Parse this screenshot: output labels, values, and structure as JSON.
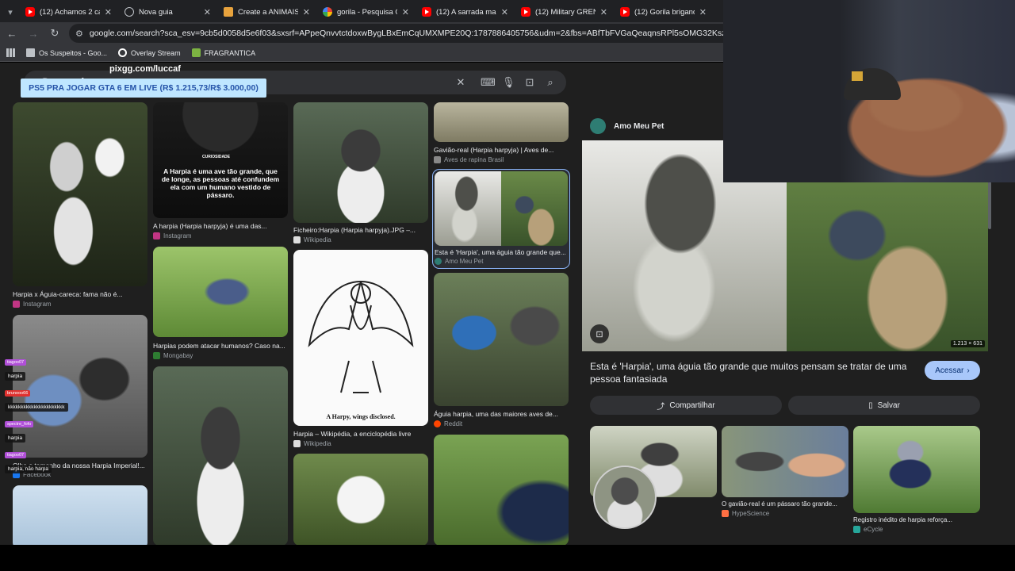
{
  "tabs": [
    {
      "title": "(12) Achamos 2 cangu",
      "icon": "youtube-icon",
      "active": false
    },
    {
      "title": "Nova guia",
      "icon": "globe-icon",
      "active": false
    },
    {
      "title": "Create a ANIMAIS QU",
      "icon": "doc-icon",
      "active": false
    },
    {
      "title": "gorila - Pesquisa Goo",
      "icon": "google-icon",
      "active": false
    },
    {
      "title": "(12) A sarrada mais tr",
      "icon": "youtube-icon",
      "active": false
    },
    {
      "title": "(12) Military GRENAD",
      "icon": "youtube-icon",
      "active": false
    },
    {
      "title": "(12) Gorila brigando l",
      "icon": "youtube-icon",
      "active": false
    }
  ],
  "address": {
    "url": "google.com/search?sca_esv=9cb5d0058d5e6f03&sxsrf=APpeQnvvtctdoxwBygLBxEmCqUMXMPE20Q:1787886405756&udm=2&fbs=ABfTbFVGaQeaqnsRPl5sOMG32KszkLt6nAp8aiRKj5vMjqZApKYr"
  },
  "bookmarks": [
    {
      "label": "",
      "icon": "apps-icon"
    },
    {
      "label": "Os Suspeitos - Goo...",
      "icon": "folder-icon"
    },
    {
      "label": "Overlay Stream",
      "icon": "overlay-icon"
    },
    {
      "label": "FRAGRANTICA",
      "icon": "fragrantica-icon"
    }
  ],
  "search": {
    "logo": "Google"
  },
  "overlay": {
    "stream_url": "pixgg.com/luccaf",
    "donation_text": "PS5 PRA JOGAR GTA 6 EM LIVE (R$ 1.215,73/R$ 3.000,00)"
  },
  "results": {
    "col1": [
      {
        "caption": "Harpia x Águia-careca: fama não é...",
        "source": "Instagram"
      },
      {
        "caption": "Olha o tamanho da nossa Harpia Imperial!...",
        "source": "Facebook"
      }
    ],
    "col2": [
      {
        "caption": "A harpia (Harpia harpyja) é uma das...",
        "source": "Instagram",
        "overlay_text": "A Harpia é uma ave tão grande, que de longe, as pessoas até confundem ela com um humano vestido de pássaro.",
        "overlay_tag": "CURIOSIDADE"
      },
      {
        "caption": "Harpias podem atacar humanos? Caso na...",
        "source": "Mongabay"
      }
    ],
    "col3": [
      {
        "caption": "Ficheiro:Harpia (Harpia harpyja).JPG –...",
        "source": "Wikipedia"
      },
      {
        "caption": "Harpia – Wikipédia, a enciclopédia livre",
        "source": "Wikipedia",
        "drawing_text": "A Harpy, wings disclosed."
      }
    ],
    "col4": [
      {
        "caption": "Gavião-real (Harpia harpyja) | Aves de...",
        "source": "Aves de rapina Brasil"
      },
      {
        "caption": "Esta é 'Harpia', uma águia tão grande que...",
        "source": "Amo Meu Pet"
      },
      {
        "caption": "Águia harpia, uma das maiores aves de...",
        "source": "Reddit"
      }
    ]
  },
  "panel": {
    "source": "Amo Meu Pet",
    "dimensions": "1.213 × 631",
    "title": "Esta é 'Harpia', uma águia tão grande que muitos pensam se tratar de uma pessoa fantasiada",
    "visit_label": "Acessar",
    "share_label": "Compartilhar",
    "save_label": "Salvar",
    "related": [
      {
        "caption": "",
        "source": ""
      },
      {
        "caption": "O gavião-real é um pássaro tão grande...",
        "source": "HypeScience"
      },
      {
        "caption": "Registro inédito de harpia reforça...",
        "source": "eCycle"
      }
    ]
  },
  "chat": [
    {
      "user": "tiagoo07",
      "message": "harpia",
      "color": "#b04fd8"
    },
    {
      "user": "brunooo66",
      "message": "kkkkkkkkkkkkkkkkkkkkkk",
      "color": "#e0312f"
    },
    {
      "user": "spectre_fofo",
      "message": "harpia",
      "color": "#b04fd8"
    },
    {
      "user": "tiagoo07",
      "message": "harpia, não harpa",
      "color": "#b04fd8"
    }
  ],
  "colors": {
    "accent": "#a8c7fa",
    "page_bg": "#1f1f1f",
    "donation_bg": "#bfe6ff"
  }
}
